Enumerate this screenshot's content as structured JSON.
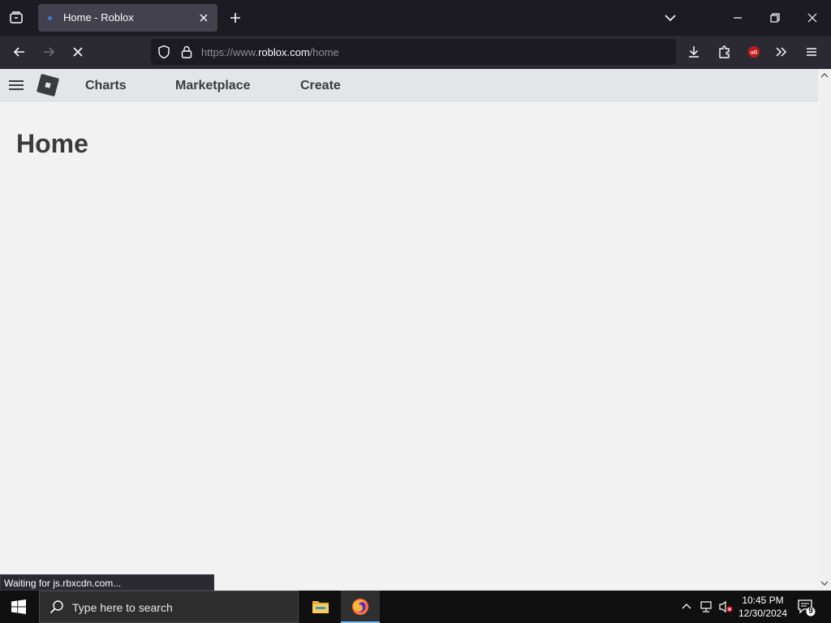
{
  "browser": {
    "tab": {
      "title": "Home - Roblox"
    },
    "url": {
      "prefix": "https://www.",
      "host": "roblox.com",
      "path": "/home"
    },
    "status": "Waiting for js.rbxcdn.com..."
  },
  "site": {
    "nav": [
      "Charts",
      "Marketplace",
      "Create"
    ],
    "page_title": "Home"
  },
  "taskbar": {
    "search_placeholder": "Type here to search",
    "time": "10:45 PM",
    "date": "12/30/2024",
    "notification_count": "9"
  },
  "colors": {
    "accent": "#76b9ed",
    "page_bg": "#f2f2f2",
    "header_bg": "#e3e6e8",
    "text": "#393b3d"
  }
}
